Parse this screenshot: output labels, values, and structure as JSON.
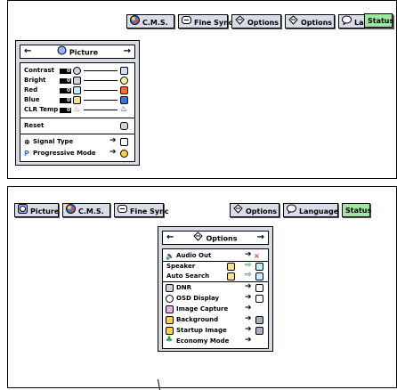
{
  "top_panel": {
    "tabs": [
      {
        "label": "C.M.S.",
        "icon": "cms-icon"
      },
      {
        "label": "Fine Sync",
        "icon": "fine-sync-icon"
      },
      {
        "label": "Options",
        "icon": "options-icon"
      },
      {
        "label": "Options",
        "icon": "options-icon"
      },
      {
        "label": "Language",
        "icon": "language-icon"
      },
      {
        "label": "Status"
      }
    ],
    "menu": {
      "title": "Picture",
      "left_arrow": "←",
      "right_arrow": "→",
      "items": [
        {
          "label": "Contrast",
          "value": "0",
          "end_color": "#cfe0ff"
        },
        {
          "label": "Bright",
          "value": "0",
          "end_color": "#fff6a0"
        },
        {
          "label": "Red",
          "value": "0",
          "end_color": "#ff6a2a"
        },
        {
          "label": "Blue",
          "value": "0",
          "end_color": "#3a72e0"
        },
        {
          "label": "CLR Temp",
          "value": "0",
          "end_color": "#ff3a3a"
        }
      ],
      "reset": "Reset",
      "signal_type": "Signal Type",
      "progressive_mode": "Progressive Mode"
    }
  },
  "bottom_panel": {
    "tabs": [
      {
        "label": "Picture",
        "icon": "picture-icon"
      },
      {
        "label": "C.M.S.",
        "icon": "cms-icon"
      },
      {
        "label": "Fine Sync",
        "icon": "fine-sync-icon"
      },
      {
        "label": "Options",
        "icon": "options-icon"
      },
      {
        "label": "Language",
        "icon": "language-icon"
      },
      {
        "label": "Status"
      }
    ],
    "menu": {
      "title": "Options",
      "left_arrow": "←",
      "right_arrow": "→",
      "items": [
        {
          "label": "Audio Out"
        },
        {
          "label": "Speaker"
        },
        {
          "label": "Auto Search"
        },
        {
          "label": "DNR"
        },
        {
          "label": "OSD Display"
        },
        {
          "label": "Image Capture"
        },
        {
          "label": "Background"
        },
        {
          "label": "Startup Image"
        },
        {
          "label": "Economy Mode"
        }
      ]
    }
  },
  "colors": {
    "tab_bg": "#d8dde8",
    "status_bg": "#9fe6a0",
    "menu_bg": "#d6dae2",
    "accent_blue": "#3a72e0"
  }
}
